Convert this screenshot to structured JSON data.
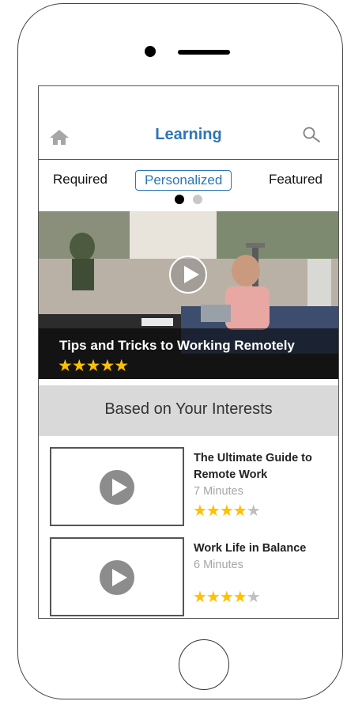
{
  "header": {
    "title": "Learning"
  },
  "tabs": [
    {
      "label": "Required"
    },
    {
      "label": "Personalized"
    },
    {
      "label": "Featured"
    }
  ],
  "carousel": {
    "active_index": 0,
    "count": 2
  },
  "hero": {
    "title": "Tips and Tricks to Working Remotely",
    "stars": "★★★★★",
    "rating": 5
  },
  "section": {
    "title": "Based on Your Interests"
  },
  "courses": [
    {
      "title": "The Ultimate Guide to Remote Work",
      "duration": "7 Minutes",
      "stars_on": "★★★★",
      "stars_off": "★",
      "rating": 4
    },
    {
      "title": "Work Life in Balance",
      "duration": "6 Minutes",
      "stars_on": "★★★★",
      "stars_off": "★",
      "rating": 4
    }
  ],
  "colors": {
    "accent": "#2e75b6",
    "star": "#ffc000",
    "star_empty": "#bfbfbf",
    "section_bg": "#d9d9d9"
  },
  "icons": [
    "home-icon",
    "search-icon",
    "play-icon"
  ]
}
